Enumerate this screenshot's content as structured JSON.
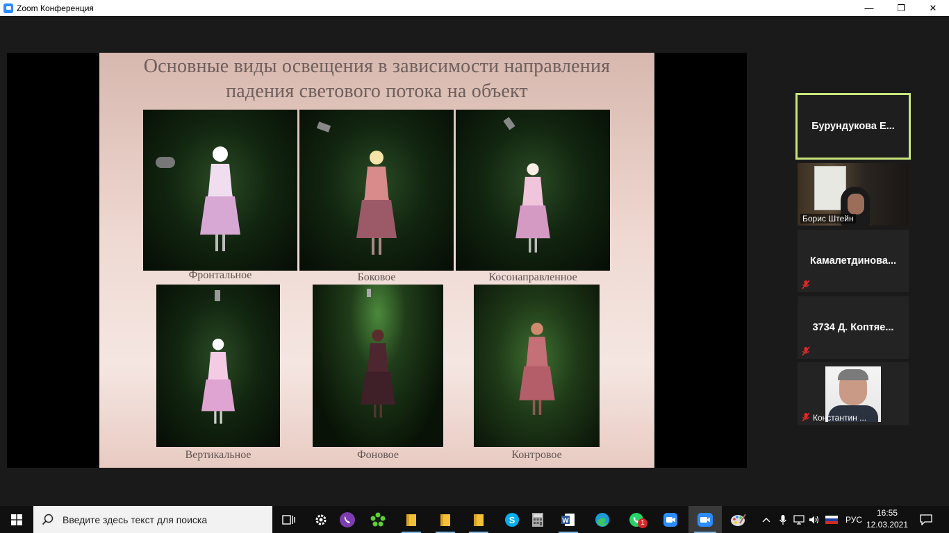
{
  "window": {
    "title": "Zoom Конференция",
    "controls": {
      "minimize": "—",
      "restore": "❐",
      "close": "✕"
    }
  },
  "slide": {
    "title_line1": "Основные виды освещения в зависимости направления",
    "title_line2": "падения светового потока на объект",
    "captions": {
      "frontal": "Фронтальное",
      "side": "Боковое",
      "oblique": "Косонаправленное",
      "vertical": "Вертикальное",
      "background": "Фоновое",
      "contra": "Контровое"
    }
  },
  "participants": [
    {
      "name": "Бурундукова  Е...",
      "active": true,
      "muted": false
    },
    {
      "name": "Борис Штейн",
      "video": true,
      "muted": false
    },
    {
      "name": "Камалетдинова...",
      "muted": true
    },
    {
      "name": "3734 Д. Коптяе...",
      "muted": true
    },
    {
      "name": "Константин ...",
      "video": true,
      "muted": true
    }
  ],
  "taskbar": {
    "search_placeholder": "Введите здесь текст для поиска",
    "apps": [
      "task-view",
      "settings",
      "viber",
      "icq",
      "file-explorer",
      "file-explorer",
      "file-explorer",
      "skype",
      "calculator",
      "word",
      "edge",
      "whatsapp",
      "zoom",
      "zoom-meeting",
      "paint"
    ],
    "whatsapp_badge": "1",
    "language": "РУС",
    "time": "16:55",
    "date": "12.03.2021"
  },
  "colors": {
    "active_speaker_border": "#c8e57a",
    "zoom_blue": "#2d8cff",
    "mute_red": "#e02828"
  }
}
